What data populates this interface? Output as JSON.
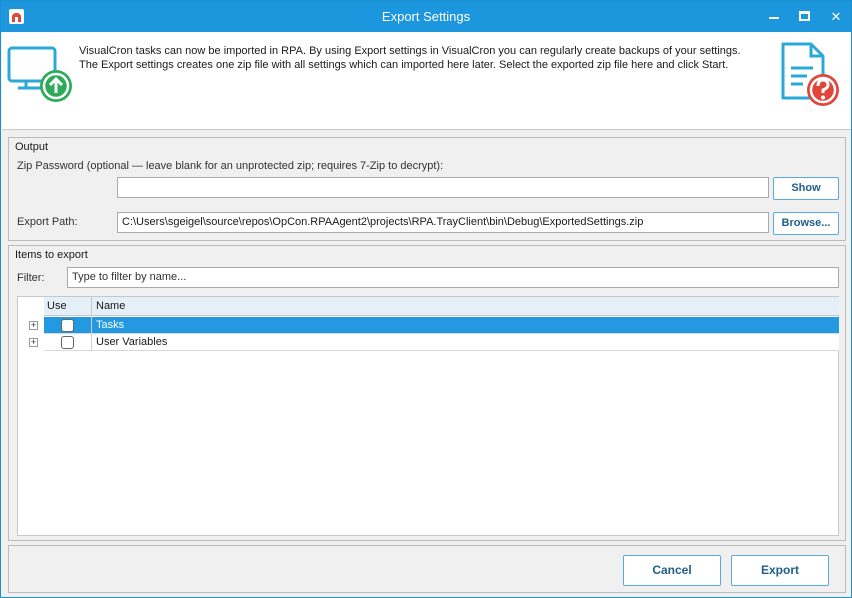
{
  "window": {
    "title": "Export Settings"
  },
  "header": {
    "description_line1": "VisualCron tasks can now be imported in RPA. By using Export settings in VisualCron you can regularly create backups of your settings.",
    "description_line2": "The Export settings creates one zip file with all settings which can imported here later. Select the exported zip file here and click Start.",
    "left_icon": "monitor-upload-icon",
    "right_icon": "document-question-icon",
    "colors": {
      "teal": "#2aa8d8",
      "green": "#2eaa5a",
      "red": "#e0463c"
    }
  },
  "output": {
    "section_title": "Output",
    "password_label": "Zip Password (optional — leave blank for an unprotected zip; requires 7-Zip to decrypt):",
    "password_value": "",
    "show_button": "Show",
    "export_path_label": "Export Path:",
    "export_path_value": "C:\\Users\\sgeigel\\source\\repos\\OpCon.RPAAgent2\\projects\\RPA.TrayClient\\bin\\Debug\\ExportedSettings.zip",
    "browse_button": "Browse..."
  },
  "items": {
    "section_title": "Items to export",
    "filter_label": "Filter:",
    "filter_placeholder": "Type to filter by name...",
    "columns": {
      "use": "Use",
      "name": "Name"
    },
    "rows": [
      {
        "name": "Tasks",
        "checked": false,
        "selected": true
      },
      {
        "name": "User Variables",
        "checked": false,
        "selected": false
      }
    ]
  },
  "footer": {
    "cancel_button": "Cancel",
    "export_button": "Export"
  },
  "theme": {
    "accent": "#1c97de",
    "selection": "#2299e0",
    "button_text": "#1f5f8a"
  }
}
